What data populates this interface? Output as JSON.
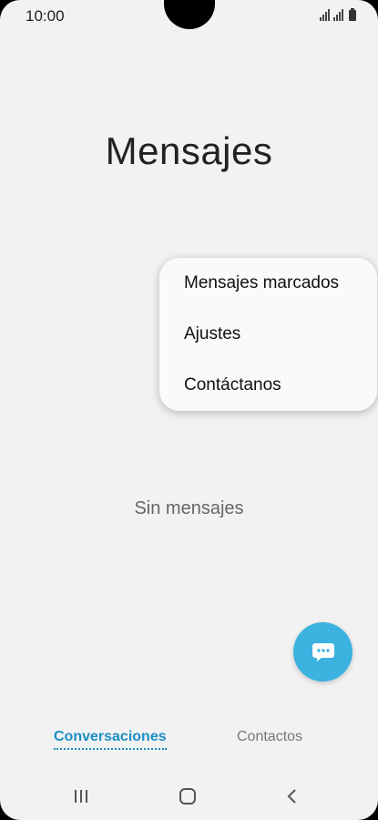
{
  "status_bar": {
    "time": "10:00",
    "icons": [
      "signal-icon",
      "signal-icon",
      "battery-icon"
    ]
  },
  "page": {
    "title": "Mensajes",
    "empty_message": "Sin mensajes"
  },
  "popup_menu": {
    "items": [
      {
        "label": "Mensajes marcados"
      },
      {
        "label": "Ajustes"
      },
      {
        "label": "Contáctanos"
      }
    ]
  },
  "fab": {
    "icon": "chat-bubble-icon",
    "color": "#3bb2e0"
  },
  "bottom_tabs": {
    "active": "Conversaciones",
    "tabs": [
      {
        "label": "Conversaciones",
        "active": true
      },
      {
        "label": "Contactos",
        "active": false
      }
    ],
    "active_color": "#1a8fc6"
  },
  "navigation_bar": {
    "buttons": [
      "recent-apps-icon",
      "home-icon",
      "back-icon"
    ]
  }
}
